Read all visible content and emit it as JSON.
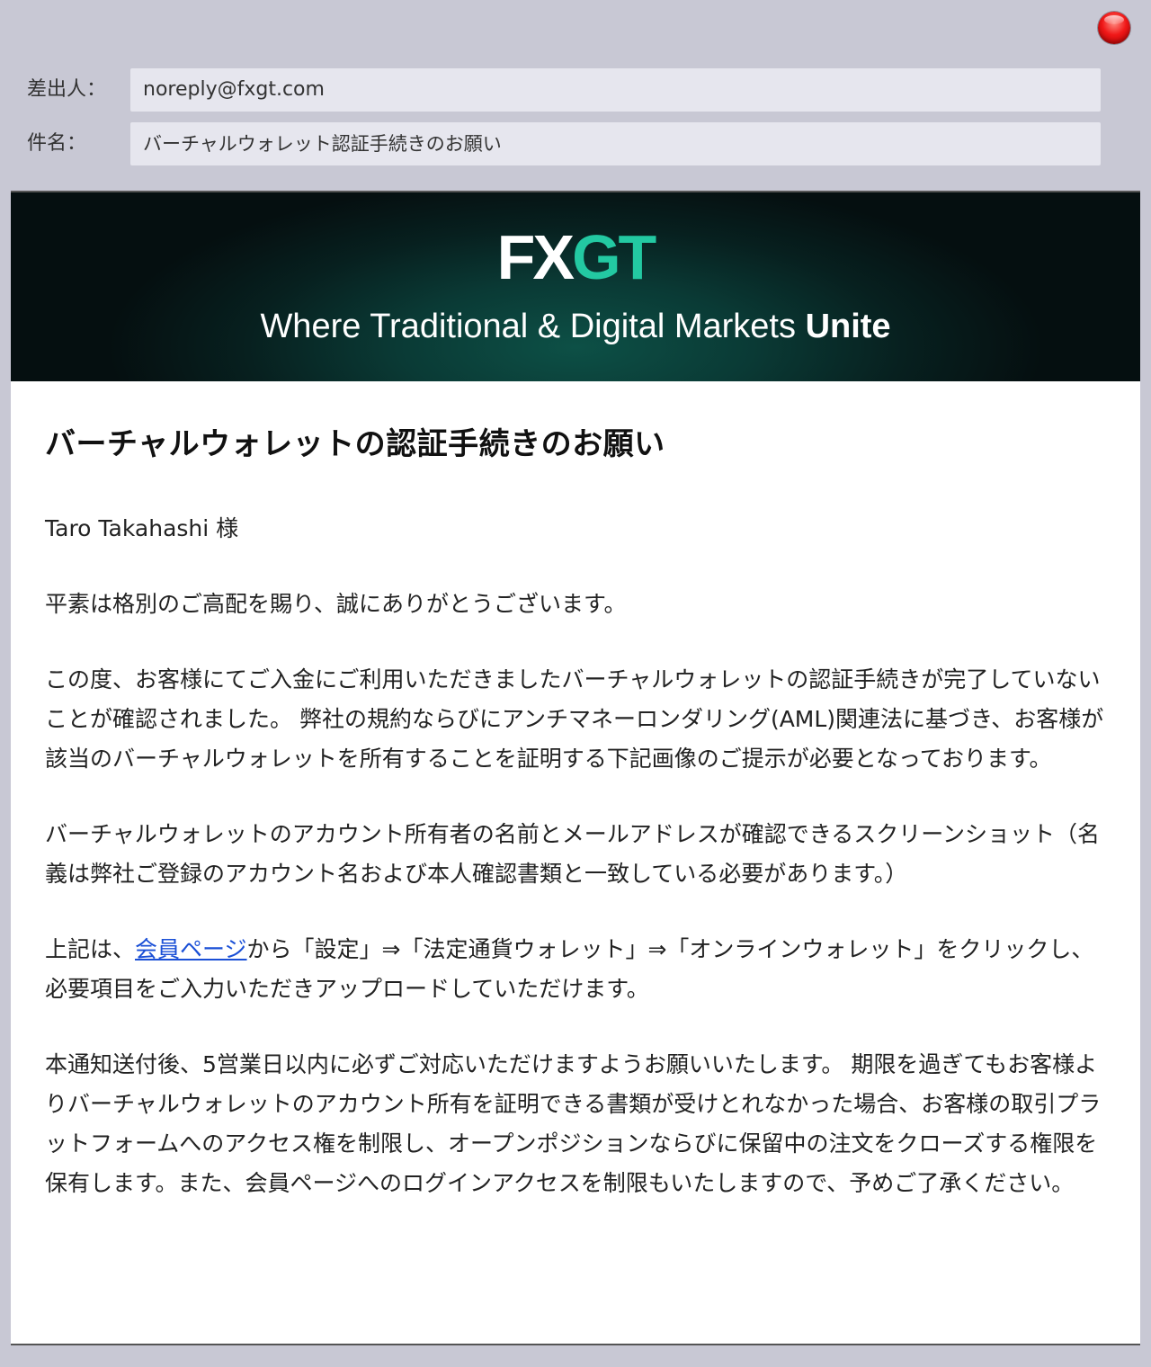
{
  "header": {
    "from_label": "差出人：",
    "from_value": "noreply@fxgt.com",
    "subject_label": "件名：",
    "subject_value": "バーチャルウォレット認証手続きのお願い"
  },
  "banner": {
    "logo_fx": "FX",
    "logo_gt": "GT",
    "tagline": "Where Traditional & Digital Markets",
    "tagline_strong": "Unite"
  },
  "body": {
    "title": "バーチャルウォレットの認証手続きのお願い",
    "greeting": "Taro Takahashi 様",
    "para1": "平素は格別のご高配を賜り、誠にありがとうございます。",
    "para2": "この度、お客様にてご入金にご利用いただきましたバーチャルウォレットの認証手続きが完了していないことが確認されました。 弊社の規約ならびにアンチマネーロンダリング(AML)関連法に基づき、お客様が該当のバーチャルウォレットを所有することを証明する下記画像のご提示が必要となっております。",
    "para3": "バーチャルウォレットのアカウント所有者の名前とメールアドレスが確認できるスクリーンショット（名義は弊社ご登録のアカウント名および本人確認書類と一致している必要があります。）",
    "para4_prefix": "上記は、",
    "para4_link": "会員ページ",
    "para4_suffix": "から「設定」⇒「法定通貨ウォレット」⇒「オンラインウォレット」をクリックし、必要項目をご入力いただきアップロードしていただけます。",
    "para5": "本通知送付後、5営業日以内に必ずご対応いただけますようお願いいたします。 期限を過ぎてもお客様よりバーチャルウォレットのアカウント所有を証明できる書類が受けとれなかった場合、お客様の取引プラットフォームへのアクセス権を制限し、オープンポジションならびに保留中の注文をクローズする権限を保有します。また、会員ページへのログインアクセスを制限もいたしますので、予めご了承ください。"
  },
  "colors": {
    "link": "#1a4fd6",
    "brand_green": "#23c9a2",
    "close_button": "#f01818"
  }
}
